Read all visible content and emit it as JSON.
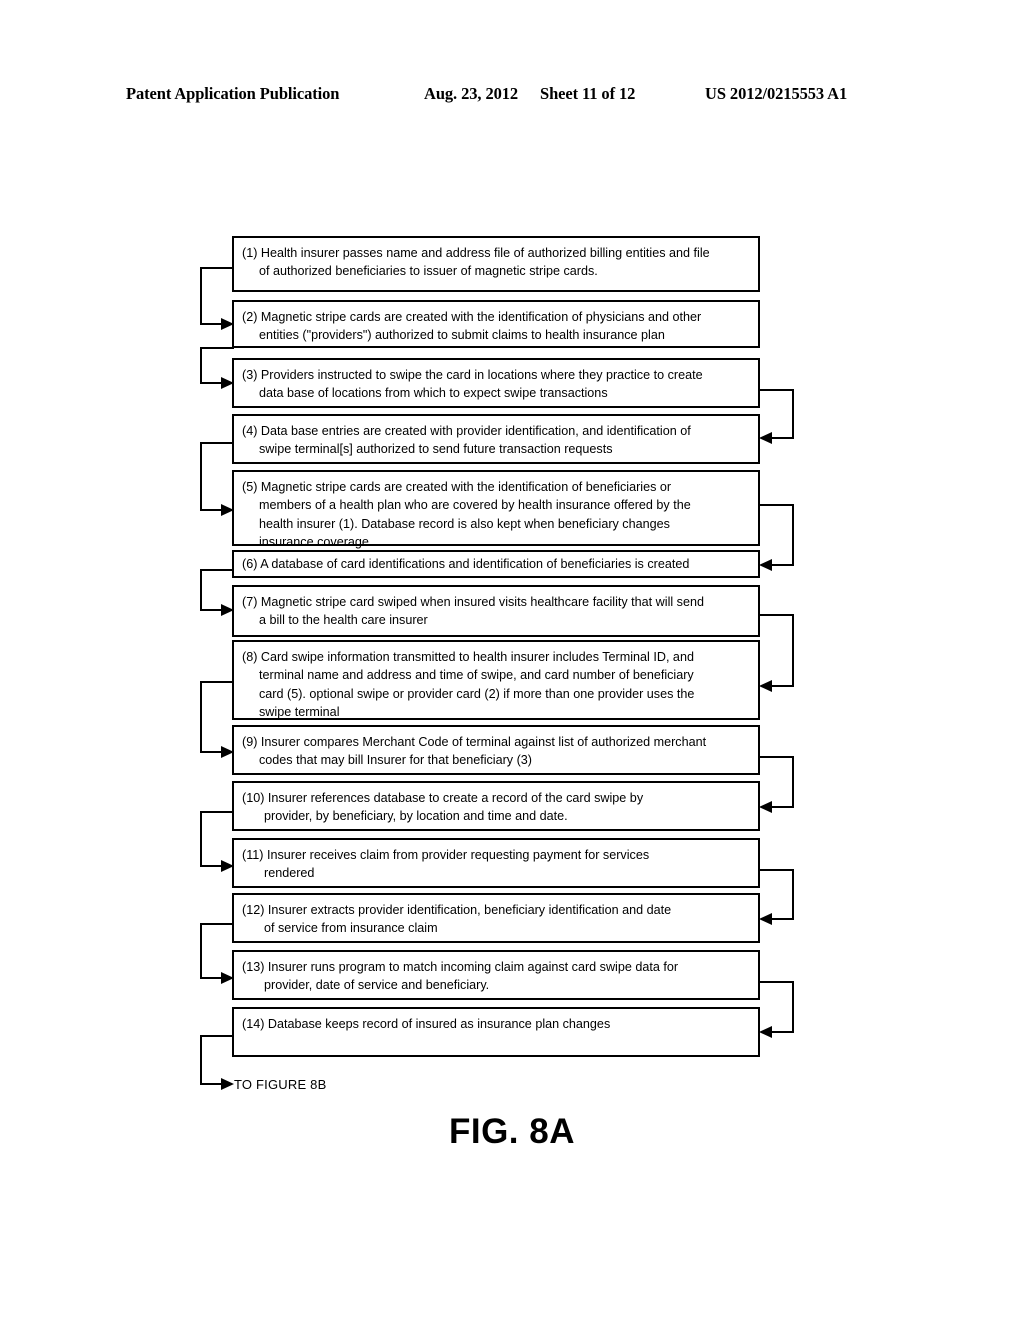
{
  "header": {
    "publication": "Patent Application Publication",
    "date": "Aug. 23, 2012",
    "sheet": "Sheet 11 of 12",
    "patent_number": "US 2012/0215553 A1"
  },
  "figure": {
    "caption": "FIG. 8A",
    "continuation_label": "TO FIGURE 8B"
  },
  "flowchart": {
    "type": "flowchart",
    "orientation": "vertical-serpentine",
    "box_count": 14,
    "boxes": [
      {
        "number": "(1)",
        "text": "(1) Health insurer passes name and address file of authorized billing entities and file\nof authorized beneficiaries to issuer of magnetic stripe cards."
      },
      {
        "number": "(2)",
        "text": "(2) Magnetic stripe cards are created with the identification of physicians and other\nentities (\"providers\") authorized to submit claims to health insurance plan"
      },
      {
        "number": "(3)",
        "text": "(3) Providers instructed to swipe the card in locations where they practice to create\ndata base of locations from which to expect swipe transactions"
      },
      {
        "number": "(4)",
        "text": "(4) Data base entries are created with provider identification, and identification of\nswipe terminal[s] authorized to send future transaction requests"
      },
      {
        "number": "(5)",
        "text": "(5) Magnetic stripe cards are created with the identification of beneficiaries or\nmembers of a health plan who are covered by health insurance offered by the\nhealth insurer (1). Database record is also kept when beneficiary changes\ninsurance coverage"
      },
      {
        "number": "(6)",
        "text": "(6) A database of card identifications and identification of beneficiaries is created"
      },
      {
        "number": "(7)",
        "text": "(7) Magnetic stripe card swiped when insured visits healthcare facility that will send\na bill to the health care insurer"
      },
      {
        "number": "(8)",
        "text": "(8) Card swipe information transmitted to health insurer includes Terminal ID, and\nterminal name and address and time of swipe, and card number of beneficiary\ncard (5). optional swipe or provider card (2) if more than one provider uses the\nswipe terminal"
      },
      {
        "number": "(9)",
        "text": "(9) Insurer compares Merchant Code of terminal against list of authorized merchant\ncodes that may bill Insurer for that beneficiary (3)"
      },
      {
        "number": "(10)",
        "text": "(10) Insurer references database to create a record of the card swipe by\nprovider, by beneficiary, by location and time and date."
      },
      {
        "number": "(11)",
        "text": "(11) Insurer receives claim from provider requesting payment for services\nrendered"
      },
      {
        "number": "(12)",
        "text": "(12) Insurer extracts provider identification, beneficiary identification and date\nof service from insurance claim"
      },
      {
        "number": "(13)",
        "text": "(13) Insurer runs program to match incoming claim against card swipe data for\nprovider, date of service and beneficiary."
      },
      {
        "number": "(14)",
        "text": "(14) Database keeps record of insured as insurance plan changes"
      }
    ],
    "connectors": [
      {
        "from": "1",
        "to": "2",
        "side": "left"
      },
      {
        "from": "2",
        "to": "3",
        "side": "left"
      },
      {
        "from": "3",
        "to": "4",
        "side": "right"
      },
      {
        "from": "4",
        "to": "5",
        "side": "left"
      },
      {
        "from": "5",
        "to": "6",
        "side": "right"
      },
      {
        "from": "6",
        "to": "7",
        "side": "left"
      },
      {
        "from": "7",
        "to": "8",
        "side": "right"
      },
      {
        "from": "8",
        "to": "9",
        "side": "left"
      },
      {
        "from": "9",
        "to": "10",
        "side": "right"
      },
      {
        "from": "10",
        "to": "11",
        "side": "left"
      },
      {
        "from": "11",
        "to": "12",
        "side": "right"
      },
      {
        "from": "12",
        "to": "13",
        "side": "left"
      },
      {
        "from": "13",
        "to": "14",
        "side": "right"
      },
      {
        "from": "14",
        "to": "TO FIGURE 8B",
        "side": "left"
      }
    ]
  },
  "colors": {
    "ink": "#000000",
    "paper": "#ffffff"
  }
}
